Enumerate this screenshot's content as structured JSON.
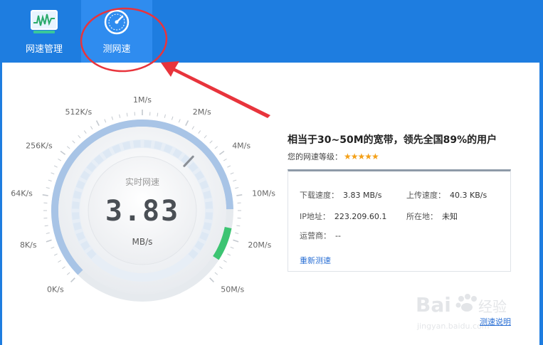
{
  "nav": {
    "tabs": [
      {
        "label": "网速管理",
        "icon": "monitor-chart-icon"
      },
      {
        "label": "测网速",
        "icon": "speedometer-icon"
      }
    ]
  },
  "gauge": {
    "title": "实时网速",
    "value": "3.83",
    "unit": "MB/s",
    "scale_labels": [
      "0K/s",
      "8K/s",
      "64K/s",
      "256K/s",
      "512K/s",
      "1M/s",
      "2M/s",
      "4M/s",
      "10M/s",
      "20M/s",
      "50M/s"
    ]
  },
  "result": {
    "headline": "相当于30~50M的宽带，领先全国89%的用户",
    "rating_label": "您的网速等级：",
    "rating_stars": 4.5,
    "rating_max": 5,
    "download_label": "下载速度：",
    "download_value": "3.83 MB/s",
    "upload_label": "上传速度：",
    "upload_value": "40.3 KB/s",
    "ip_label": "IP地址：",
    "ip_value": "223.209.60.1",
    "location_label": "所在地：",
    "location_value": "未知",
    "isp_label": "运营商：",
    "isp_value": "--",
    "retest_label": "重新测速"
  },
  "footer": {
    "help_label": "测速说明"
  },
  "watermark": {
    "brand": "Bai",
    "sub": "jingyan.baidu.com",
    "cn": "经验"
  },
  "colors": {
    "accent": "#1e7de0",
    "annotation": "#e8343c",
    "gauge_green": "#3cc472",
    "star": "#f4a018"
  }
}
